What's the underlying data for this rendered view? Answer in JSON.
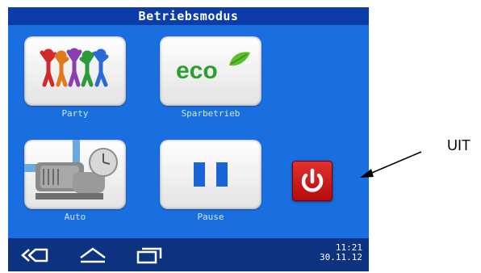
{
  "window": {
    "title": "Betriebsmodus"
  },
  "modes": [
    {
      "label": "Party",
      "icon": "party-people-icon"
    },
    {
      "label": "Sparbetrieb",
      "icon": "eco-leaf-icon",
      "icon_text": "eco"
    },
    {
      "label": "Auto",
      "icon": "pump-timer-icon"
    },
    {
      "label": "Pause",
      "icon": "pause-icon"
    }
  ],
  "power_button": {
    "icon": "power-icon",
    "color": "#d81e1e"
  },
  "navigation": [
    {
      "icon": "back-icon"
    },
    {
      "icon": "home-icon"
    },
    {
      "icon": "recent-apps-icon"
    }
  ],
  "status": {
    "time": "11:21",
    "date": "30.11.12"
  },
  "annotation": {
    "label": "UIT"
  },
  "colors": {
    "screen": "#1a6fe0",
    "titlebar": "#0b3ca8",
    "bottombar": "#0d3380",
    "eco_green": "#2e9e2e"
  }
}
